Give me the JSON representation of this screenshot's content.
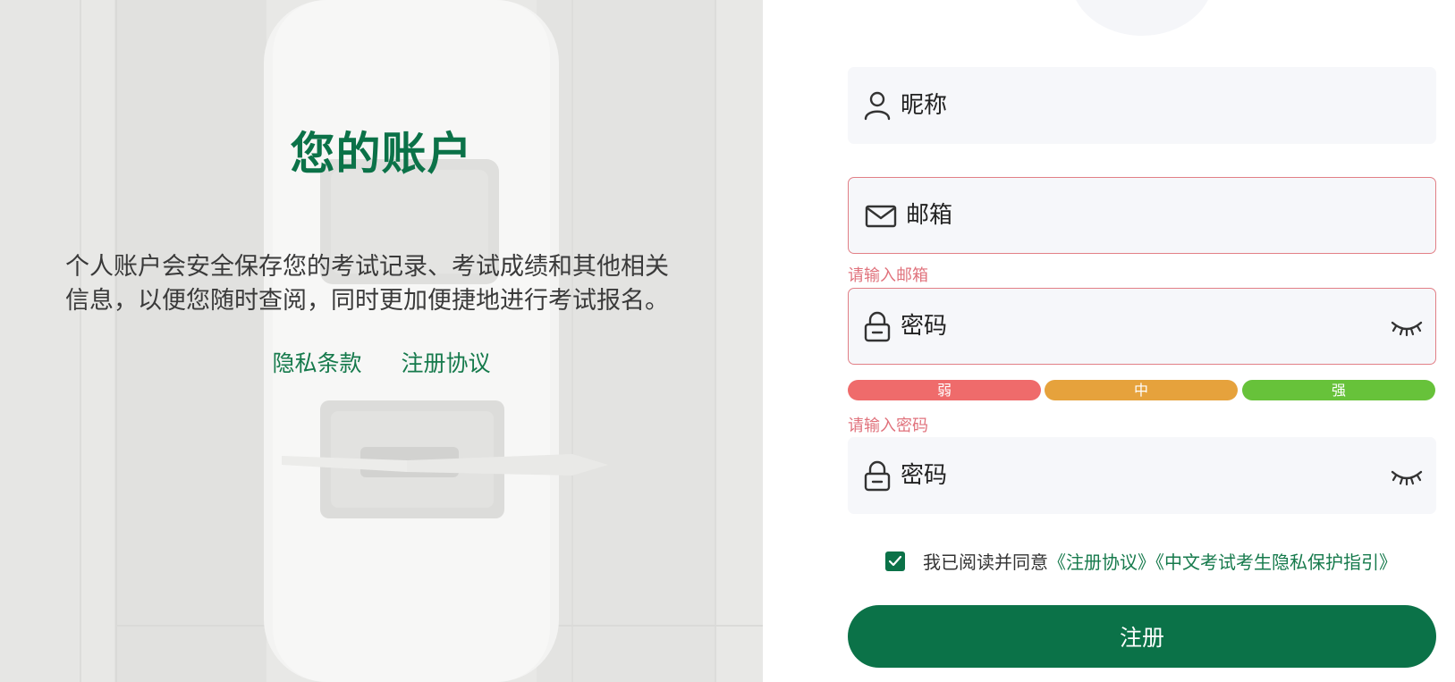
{
  "left_panel": {
    "title": "您的账户",
    "description_line1": "个人账户会安全保存您的考试记录、考试成绩和其他相关",
    "description_line2": "信息，以便您随时查阅，同时更加便捷地进行考试报名。",
    "privacy_link": "隐私条款",
    "register_agreement_link": "注册协议"
  },
  "form": {
    "nickname": {
      "placeholder": "昵称",
      "value": ""
    },
    "email": {
      "placeholder": "邮箱",
      "value": "",
      "error": "请输入邮箱"
    },
    "password": {
      "placeholder": "密码",
      "value": "",
      "error": "请输入密码"
    },
    "confirm_password": {
      "placeholder": "密码",
      "value": ""
    },
    "strength": {
      "weak": "弱",
      "medium": "中",
      "strong": "强"
    },
    "agreement": {
      "checked": true,
      "prefix": "我已阅读并同意",
      "link1": "《注册协议》",
      "link2": "《中文考试考生隐私保护指引》"
    },
    "submit_label": "注册"
  },
  "colors": {
    "brand_green": "#0b7248",
    "link_green": "#167a4c",
    "error_red": "#e0727c",
    "weak": "#ef6b6b",
    "medium": "#e6a23c",
    "strong": "#67c23a",
    "input_bg": "#f6f7fa"
  },
  "icons": {
    "nickname": "user-icon",
    "email": "mail-icon",
    "password": "lock-icon",
    "toggle": "eye-closed-icon"
  }
}
